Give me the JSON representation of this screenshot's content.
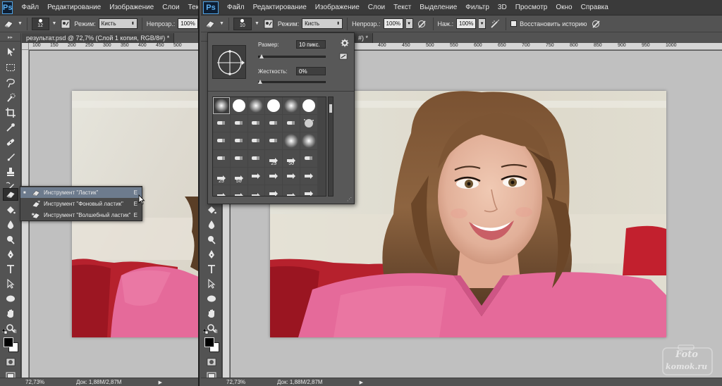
{
  "app": {
    "logo": "Ps",
    "menu": [
      "Файл",
      "Редактирование",
      "Изображение",
      "Слои",
      "Текст",
      "Выделение",
      "Фильтр",
      "3D",
      "Просмотр",
      "Окно",
      "Справка"
    ]
  },
  "left_pane": {
    "options": {
      "brush_size": "12",
      "mode_label": "Режим:",
      "mode_value": "Кисть",
      "opacity_label": "Непрозр.:",
      "opacity_value": "100%"
    },
    "document_tab": "результат.psd @ 72,7% (Слой 1 копия, RGB/8#) *",
    "ruler_labels": [
      "100",
      "150",
      "200",
      "250",
      "300",
      "350",
      "400",
      "450",
      "500"
    ],
    "status": {
      "zoom": "72,73%",
      "doc": "Док: 1,88M/2,87M"
    },
    "flyout": [
      {
        "label": "Инструмент \"Ластик\"",
        "key": "E",
        "selected": true
      },
      {
        "label": "Инструмент \"Фоновый ластик\"",
        "key": "E",
        "selected": false
      },
      {
        "label": "Инструмент \"Волшебный ластик\"",
        "key": "E",
        "selected": false
      }
    ]
  },
  "right_pane": {
    "options": {
      "brush_size": "10",
      "mode_label": "Режим:",
      "mode_value": "Кисть",
      "opacity_label": "Непрозр.:",
      "opacity_value": "100%",
      "flow_label": "Наж.:",
      "flow_value": "100%",
      "history_label": "Восстановить историю"
    },
    "document_tab": "#) *",
    "ruler_labels": [
      "400",
      "450",
      "500",
      "550",
      "600",
      "650",
      "700",
      "750",
      "800",
      "850",
      "900",
      "950",
      "1000"
    ],
    "status": {
      "zoom": "72,73%",
      "doc": "Док: 1,88M/2,87M"
    }
  },
  "brush_picker": {
    "size_label": "Размер:",
    "size_value": "10 пикс.",
    "size_level": 0.02,
    "hardness_label": "Жесткость:",
    "hardness_value": "0%",
    "hardness_level": 0.0,
    "presets": [
      {
        "kind": "soft",
        "num": ""
      },
      {
        "kind": "hard",
        "num": ""
      },
      {
        "kind": "soft",
        "num": ""
      },
      {
        "kind": "hard",
        "num": ""
      },
      {
        "kind": "soft",
        "num": ""
      },
      {
        "kind": "hard",
        "num": ""
      },
      {
        "kind": "dry",
        "num": ""
      },
      {
        "kind": "dry",
        "num": ""
      },
      {
        "kind": "dry",
        "num": ""
      },
      {
        "kind": "dry",
        "num": ""
      },
      {
        "kind": "dry",
        "num": ""
      },
      {
        "kind": "spray",
        "num": ""
      },
      {
        "kind": "dry",
        "num": ""
      },
      {
        "kind": "dry",
        "num": ""
      },
      {
        "kind": "dry",
        "num": ""
      },
      {
        "kind": "dry",
        "num": ""
      },
      {
        "kind": "soft",
        "num": ""
      },
      {
        "kind": "soft",
        "num": ""
      },
      {
        "kind": "dry",
        "num": ""
      },
      {
        "kind": "dry",
        "num": ""
      },
      {
        "kind": "dry",
        "num": ""
      },
      {
        "kind": "arrow",
        "num": "25"
      },
      {
        "kind": "arrow",
        "num": "50"
      },
      {
        "kind": "dry",
        "num": ""
      },
      {
        "kind": "arrow",
        "num": "25"
      },
      {
        "kind": "arrow",
        "num": "50"
      },
      {
        "kind": "arrow",
        "num": ""
      },
      {
        "kind": "arrow",
        "num": ""
      },
      {
        "kind": "arrow",
        "num": ""
      },
      {
        "kind": "arrow",
        "num": ""
      },
      {
        "kind": "arrow",
        "num": "36"
      },
      {
        "kind": "arrow",
        "num": "30"
      },
      {
        "kind": "arrow",
        "num": "30"
      },
      {
        "kind": "arrow",
        "num": ""
      },
      {
        "kind": "arrow",
        "num": "9"
      },
      {
        "kind": "arrow",
        "num": ""
      }
    ]
  },
  "watermark": {
    "line1": "Foto",
    "line2": "komok.ru"
  },
  "colors": {
    "panel": "#535353",
    "menubar": "#3a3a3a",
    "canvas": "#c0c0c0",
    "accent_selection": "#6d7b8d",
    "ps_blue": "#5db1f2",
    "sweater": "#e56a9a",
    "cushion": "#b6212d"
  }
}
